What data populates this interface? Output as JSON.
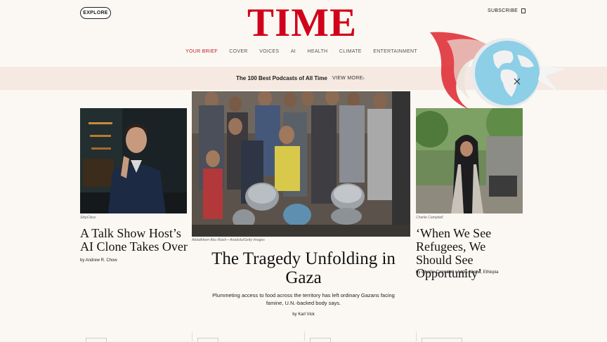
{
  "header": {
    "explore_label": "EXPLORE",
    "logo": "TIME",
    "subscribe_label": "SUBSCRIBE"
  },
  "nav": {
    "items": [
      "YOUR BRIEF",
      "COVER",
      "VOICES",
      "AI",
      "HEALTH",
      "CLIMATE",
      "ENTERTAINMENT"
    ],
    "active_index": 0
  },
  "promo": {
    "text": "The 100 Best Podcasts of All Time",
    "link": "VIEW MORE"
  },
  "left_story": {
    "caption": "SkipClass",
    "headline": "A Talk Show Host’s AI Clone Takes Over",
    "byline": "by Andrew R. Chow"
  },
  "main_story": {
    "caption": "Abdalhkem Abu Riash—Anadolu/Getty Images",
    "headline": "The Tragedy Unfolding in Gaza",
    "summary": "Plummeting access to food across the territory has left ordinary Gazans facing famine, U.N.-backed body says.",
    "byline": "by Karl Vick"
  },
  "right_story": {
    "caption": "Charlie Campbell",
    "headline": "‘When We See Refugees, We Should See Opportunity’",
    "byline": "by Charlie Campbell / Addis Ababa, Ethiopia"
  },
  "colors": {
    "brand_red": "#d0021b",
    "promo_bg": "#f5e9e2",
    "page_bg": "#fbf8f3"
  },
  "icons": {
    "subscribe": "bookmark-icon",
    "promo_arrow": "chevron-right-icon",
    "watermark": "globe-crescent-logo"
  }
}
